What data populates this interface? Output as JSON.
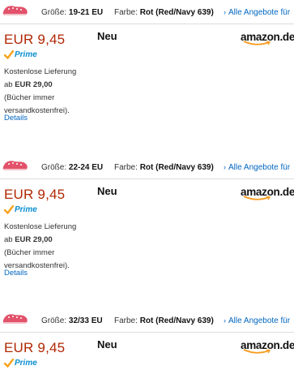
{
  "offers": [
    {
      "size_label": "Größe:",
      "size_value": "19-21 EU",
      "color_label": "Farbe:",
      "color_value": "Rot (Red/Navy 639)",
      "all_offers_link": "Alle Angebote für",
      "price": "EUR 9,45",
      "prime": "Prime",
      "condition": "Neu",
      "seller_logo": "amazon.de",
      "shipping_line1": "Kostenlose Lieferung",
      "shipping_from": "ab",
      "shipping_amount": "EUR 29,00",
      "shipping_note": "(Bücher immer versandkostenfrei).",
      "details_link": "Details"
    },
    {
      "size_label": "Größe:",
      "size_value": "22-24 EU",
      "color_label": "Farbe:",
      "color_value": "Rot (Red/Navy 639)",
      "all_offers_link": "Alle Angebote für",
      "price": "EUR 9,45",
      "prime": "Prime",
      "condition": "Neu",
      "seller_logo": "amazon.de",
      "shipping_line1": "Kostenlose Lieferung",
      "shipping_from": "ab",
      "shipping_amount": "EUR 29,00",
      "shipping_note": "(Bücher immer versandkostenfrei).",
      "details_link": "Details"
    },
    {
      "size_label": "Größe:",
      "size_value": "32/33 EU",
      "color_label": "Farbe:",
      "color_value": "Rot (Red/Navy 639)",
      "all_offers_link": "Alle Angebote für",
      "price": "EUR 9,45",
      "prime": "Prime",
      "condition": "Neu",
      "seller_logo": "amazon.de"
    }
  ],
  "colors": {
    "price": "#B12704",
    "link": "#0066c0",
    "prime": "#0a8fd1",
    "logo_smile": "#f79c1f",
    "shoe": "#e2526a"
  },
  "icons": {
    "thumbnail": "red-clog-shoe-icon",
    "prime_check": "prime-check-icon",
    "arrow": "chevron-right-icon"
  }
}
